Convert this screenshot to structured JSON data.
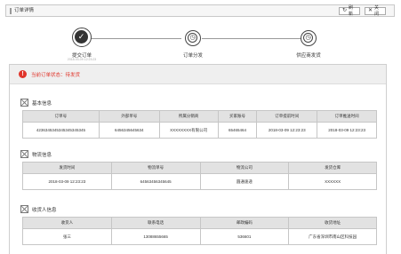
{
  "titlebar": {
    "title": "订单详情",
    "refresh_label": "刷新",
    "close_label": "关闭",
    "refresh_icon": "↻",
    "close_icon": "✕"
  },
  "steps": [
    {
      "label": "提交订单",
      "sub": "2018-03-09 12:23:23",
      "state": "done",
      "icon": "✓"
    },
    {
      "label": "订单分发",
      "sub": "",
      "state": "pending",
      "icon": "◷"
    },
    {
      "label": "供应商发货",
      "sub": "",
      "state": "pending",
      "icon": "◷"
    }
  ],
  "status": {
    "icon": "!",
    "text": "当前订单状态：待发货",
    "color": "#e0352b"
  },
  "basic": {
    "title": "基本信息",
    "headers": [
      "订单号",
      "外部单号",
      "所属分销商",
      "买家账号",
      "订单提前时间",
      "订单推送时间"
    ],
    "row": [
      "4236345345345345345345",
      "6456345645634",
      "XXXXXXXX有限公司",
      "65465464",
      "2018-03-09 12:23:23",
      "2018-03-09 12:23:23"
    ]
  },
  "logistics": {
    "title": "物流信息",
    "headers": [
      "发货时间",
      "物流单号",
      "物流公司",
      "发货仓库"
    ],
    "row": [
      "2018-03-09 12:23:23",
      "64563456345645",
      "圆通速递",
      "XXXXXX"
    ]
  },
  "receiver": {
    "title": "收货人信息",
    "headers": [
      "收货人",
      "联系电话",
      "邮政编码",
      "收货地址"
    ],
    "row": [
      "张三",
      "13088655665",
      "536601",
      "广东省深圳市南山区科技园"
    ]
  }
}
